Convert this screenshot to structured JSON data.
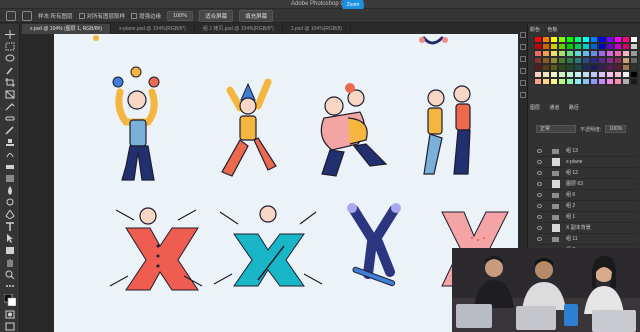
{
  "window": {
    "title": "Adobe Photoshop CC",
    "badge": "Zoom"
  },
  "options_bar": {
    "items": [
      "样本:所有图层",
      "对所有图层取样"
    ],
    "check1": "对所有图层取样",
    "check2": "增强边缘",
    "zoom": "100%",
    "btn1": "适合屏幕",
    "btn2": "填充屏幕"
  },
  "tabs": [
    {
      "label": "x.psd @ 104% (图层 1, RGB/8#)",
      "active": true
    },
    {
      "label": "x-plane.psd @ 104%(RGB/8*)",
      "active": false
    },
    {
      "label": "组 2 拷贝.psd @ 104%(RGB/8*)",
      "active": false
    },
    {
      "label": "1.psd @ 104%(RGB/8)",
      "active": false
    }
  ],
  "swatch_panel": {
    "tab1": "颜色",
    "tab2": "色板"
  },
  "swatch_colors": [
    "#ff0000",
    "#ff8000",
    "#ffff00",
    "#80ff00",
    "#00ff00",
    "#00ff80",
    "#00ffff",
    "#0080ff",
    "#0000ff",
    "#8000ff",
    "#ff00ff",
    "#ff0080",
    "#ffffff",
    "#cc0000",
    "#cc6600",
    "#cccc00",
    "#66cc00",
    "#00cc00",
    "#00cc66",
    "#00cccc",
    "#0066cc",
    "#0000cc",
    "#6600cc",
    "#cc00cc",
    "#cc0066",
    "#cccccc",
    "#e86a6a",
    "#f0a050",
    "#f5e06a",
    "#a8e070",
    "#6adc8c",
    "#5ed8c8",
    "#68b8f0",
    "#6a8ae8",
    "#9a6ae8",
    "#d26ae0",
    "#ea6aa8",
    "#f4b6c2",
    "#999999",
    "#8a3030",
    "#8a5a2a",
    "#8a8a2a",
    "#4a7a2a",
    "#2a7a4a",
    "#2a7a7a",
    "#2a4a8a",
    "#2a2a8a",
    "#5a2a8a",
    "#8a2a8a",
    "#8a2a5a",
    "#c8a07a",
    "#666666",
    "#5a1a1a",
    "#5a3a1a",
    "#5a5a1a",
    "#2a4a1a",
    "#1a4a2a",
    "#1a4a4a",
    "#1a2a5a",
    "#1a1a5a",
    "#3a1a5a",
    "#5a1a5a",
    "#5a1a3a",
    "#a07850",
    "#333333",
    "#f7d1c2",
    "#f5e4c2",
    "#eef5c2",
    "#cdf5c2",
    "#c2f5d8",
    "#c2f0f5",
    "#c2dcf5",
    "#c2c8f5",
    "#dac2f5",
    "#f5c2ee",
    "#f5c2d4",
    "#f0f0f0",
    "#000000",
    "#f4a48c",
    "#fcd48c",
    "#fcf48c",
    "#bcf48c",
    "#8cf4b4",
    "#8cecf4",
    "#8cc4f4",
    "#8c9cf4",
    "#c48cf4",
    "#f48ce4",
    "#f48cb4",
    "#b0b0b0",
    "#1a1a1a"
  ],
  "layers_panel": {
    "tabs": [
      "图层",
      "通道",
      "路径"
    ],
    "blend_mode": "正常",
    "opacity_label": "不透明度:",
    "opacity": "100%"
  },
  "layers": [
    {
      "name": "组 13",
      "type": "folder"
    },
    {
      "name": "x-plane",
      "type": "image"
    },
    {
      "name": "组 12",
      "type": "folder"
    },
    {
      "name": "图层 63",
      "type": "image"
    },
    {
      "name": "组 6",
      "type": "folder"
    },
    {
      "name": "组 2",
      "type": "folder"
    },
    {
      "name": "组 1",
      "type": "folder"
    },
    {
      "name": "X 副本背景",
      "type": "image"
    },
    {
      "name": "组 11",
      "type": "folder"
    },
    {
      "name": "组 7",
      "type": "folder"
    },
    {
      "name": "组 5",
      "type": "folder"
    },
    {
      "name": "组 4",
      "type": "folder"
    }
  ]
}
